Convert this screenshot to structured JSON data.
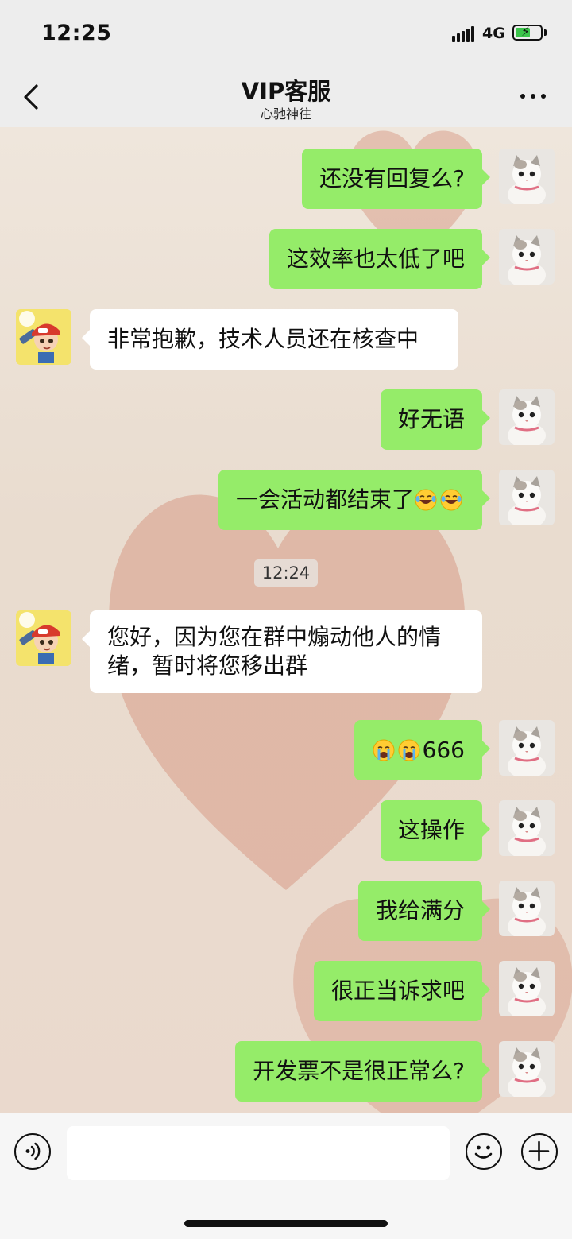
{
  "status_bar": {
    "time": "12:25",
    "network": "4G",
    "battery_level": 0.6
  },
  "header": {
    "title": "VIP客服",
    "subtitle": "心驰神往"
  },
  "messages": [
    {
      "side": "me",
      "text": "还没有回复么?"
    },
    {
      "side": "me",
      "text": "这效率也太低了吧"
    },
    {
      "side": "other",
      "text": "非常抱歉，技术人员还在核查中"
    },
    {
      "side": "me",
      "text": "好无语"
    },
    {
      "side": "me",
      "text": "一会活动都结束了",
      "emoji_suffix": [
        "laughing-tears-emoji",
        "laughing-tears-emoji"
      ]
    },
    {
      "type": "timestamp",
      "text": "12:24"
    },
    {
      "side": "other",
      "text": "您好，因为您在群中煽动他人的情绪，暂时将您移出群"
    },
    {
      "side": "me",
      "text": "666",
      "emoji_prefix": [
        "crying-emoji",
        "crying-emoji"
      ]
    },
    {
      "side": "me",
      "text": "这操作"
    },
    {
      "side": "me",
      "text": "我给满分"
    },
    {
      "side": "me",
      "text": "很正当诉求吧"
    },
    {
      "side": "me",
      "text": "开发票不是很正常么?"
    }
  ],
  "input": {
    "value": "",
    "placeholder": ""
  },
  "icons": {
    "back": "chevron-left-icon",
    "more": "more-dots-icon",
    "voice": "voice-icon",
    "emoji": "smiley-icon",
    "plus": "plus-icon",
    "my_avatar": "cat-avatar",
    "agent_avatar": "cartoon-character-avatar"
  },
  "colors": {
    "my_bubble": "#95ec69",
    "other_bubble": "#ffffff",
    "bars": "#ededed"
  }
}
